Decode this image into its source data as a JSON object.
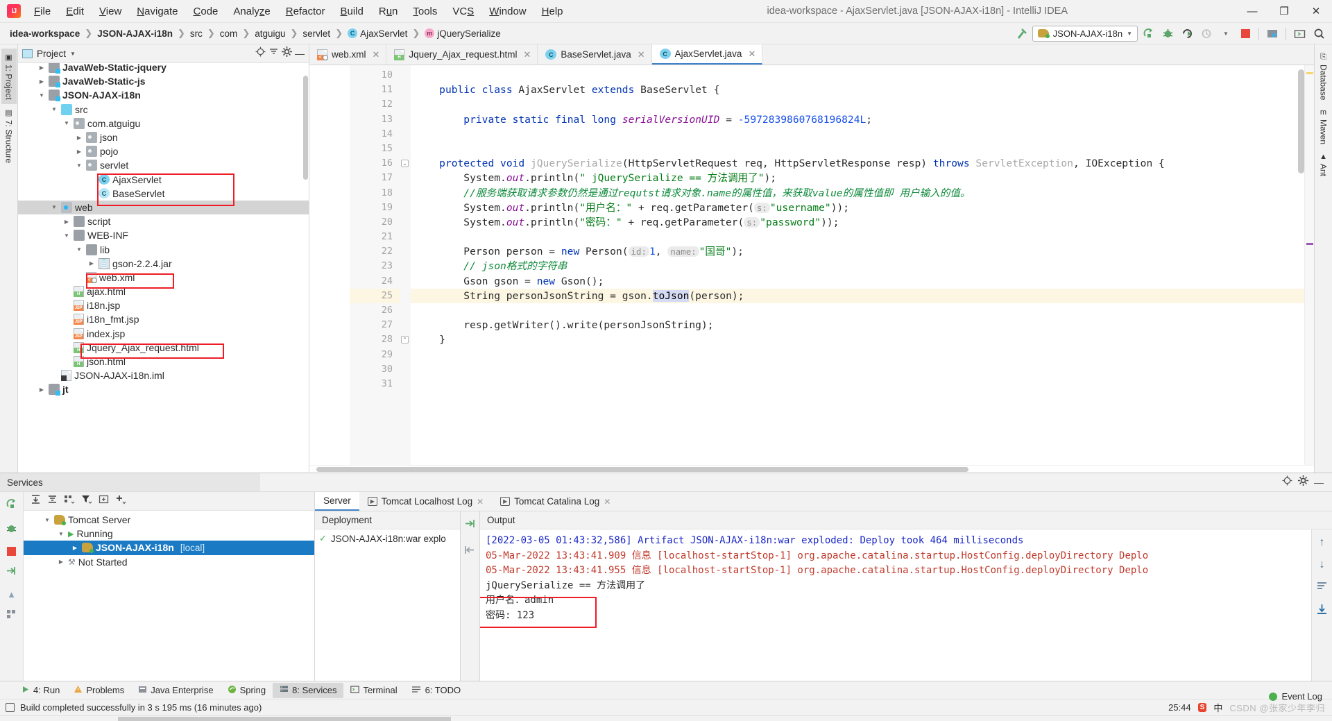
{
  "window": {
    "title": "idea-workspace - AjaxServlet.java [JSON-AJAX-i18n] - IntelliJ IDEA",
    "minimize": "—",
    "maximize": "❐",
    "close": "✕"
  },
  "menu": [
    {
      "label": "File"
    },
    {
      "label": "Edit"
    },
    {
      "label": "View"
    },
    {
      "label": "Navigate"
    },
    {
      "label": "Code"
    },
    {
      "label": "Analyze"
    },
    {
      "label": "Refactor"
    },
    {
      "label": "Build"
    },
    {
      "label": "Run"
    },
    {
      "label": "Tools"
    },
    {
      "label": "VCS"
    },
    {
      "label": "Window"
    },
    {
      "label": "Help"
    }
  ],
  "breadcrumbs": [
    {
      "label": "idea-workspace",
      "bold": true
    },
    {
      "label": "JSON-AJAX-i18n",
      "bold": true
    },
    {
      "label": "src"
    },
    {
      "label": "com"
    },
    {
      "label": "atguigu"
    },
    {
      "label": "servlet"
    },
    {
      "label": "AjaxServlet",
      "icon": "class-icon"
    },
    {
      "label": "jQuerySerialize",
      "icon": "method-icon"
    }
  ],
  "toolbar": {
    "run_config": "JSON-AJAX-i18n",
    "dropdown_caret": "▼",
    "icons": [
      "update-app-icon",
      "debug-icon",
      "run-icon",
      "profile-icon",
      "stop-icon",
      "build-project-icon",
      "terminal-icon",
      "search-everywhere-icon"
    ]
  },
  "left_rail": [
    {
      "label": "1: Project",
      "selected": true
    },
    {
      "label": "7: Structure",
      "selected": false
    }
  ],
  "right_rail": [
    {
      "label": "Database"
    },
    {
      "label": "Maven"
    },
    {
      "label": "Ant"
    }
  ],
  "project_panel": {
    "title": "Project",
    "caret": "▼",
    "tree": [
      {
        "indent": 1,
        "arrow": "▶",
        "icon": "module-folder-icon",
        "label": "JavaWeb-Static-jquery",
        "bold": true,
        "clipped": true
      },
      {
        "indent": 1,
        "arrow": "▶",
        "icon": "module-folder-icon",
        "label": "JavaWeb-Static-js",
        "bold": true
      },
      {
        "indent": 1,
        "arrow": "▼",
        "icon": "module-folder-icon",
        "label": "JSON-AJAX-i18n",
        "bold": true
      },
      {
        "indent": 2,
        "arrow": "▼",
        "icon": "source-folder-icon",
        "label": "src"
      },
      {
        "indent": 3,
        "arrow": "▼",
        "icon": "package-icon",
        "label": "com.atguigu"
      },
      {
        "indent": 4,
        "arrow": "▶",
        "icon": "package-icon",
        "label": "json"
      },
      {
        "indent": 4,
        "arrow": "▶",
        "icon": "package-icon",
        "label": "pojo"
      },
      {
        "indent": 4,
        "arrow": "▼",
        "icon": "package-icon",
        "label": "servlet"
      },
      {
        "indent": 5,
        "arrow": "",
        "icon": "class-icon",
        "label": "AjaxServlet"
      },
      {
        "indent": 5,
        "arrow": "",
        "icon": "abstract-class-icon",
        "label": "BaseServlet"
      },
      {
        "indent": 2,
        "arrow": "▼",
        "icon": "web-folder-icon",
        "label": "web",
        "selected": true
      },
      {
        "indent": 3,
        "arrow": "▶",
        "icon": "plain-folder-icon",
        "label": "script"
      },
      {
        "indent": 3,
        "arrow": "▼",
        "icon": "plain-folder-icon",
        "label": "WEB-INF"
      },
      {
        "indent": 4,
        "arrow": "▼",
        "icon": "plain-folder-icon",
        "label": "lib"
      },
      {
        "indent": 5,
        "arrow": "▶",
        "icon": "jar-icon",
        "label": "gson-2.2.4.jar"
      },
      {
        "indent": 4,
        "arrow": "",
        "icon": "xml-file-icon",
        "label": "web.xml"
      },
      {
        "indent": 3,
        "arrow": "",
        "icon": "html-file-icon",
        "label": "ajax.html"
      },
      {
        "indent": 3,
        "arrow": "",
        "icon": "jsp-file-icon",
        "label": "i18n.jsp"
      },
      {
        "indent": 3,
        "arrow": "",
        "icon": "jsp-file-icon",
        "label": "i18n_fmt.jsp"
      },
      {
        "indent": 3,
        "arrow": "",
        "icon": "jsp-file-icon",
        "label": "index.jsp"
      },
      {
        "indent": 3,
        "arrow": "",
        "icon": "html-file-icon",
        "label": "Jquery_Ajax_request.html"
      },
      {
        "indent": 3,
        "arrow": "",
        "icon": "html-file-icon",
        "label": "json.html"
      },
      {
        "indent": 2,
        "arrow": "",
        "icon": "iml-file-icon",
        "label": "JSON-AJAX-i18n.iml"
      },
      {
        "indent": 1,
        "arrow": "▶",
        "icon": "module-folder-icon",
        "label": "jt",
        "bold": true
      }
    ]
  },
  "editor": {
    "tabs": [
      {
        "label": "web.xml",
        "icon": "xml-file-icon",
        "active": false
      },
      {
        "label": "Jquery_Ajax_request.html",
        "icon": "html-file-icon",
        "active": false
      },
      {
        "label": "BaseServlet.java",
        "icon": "class-icon",
        "active": false
      },
      {
        "label": "AjaxServlet.java",
        "icon": "class-icon",
        "active": true
      }
    ],
    "first_line": 10,
    "highlight_line": 25,
    "lines": [
      {
        "n": 10,
        "segments": []
      },
      {
        "n": 11,
        "segments": [
          {
            "t": "    ",
            "c": "plain"
          },
          {
            "t": "public",
            "c": "kw"
          },
          {
            "t": " ",
            "c": "plain"
          },
          {
            "t": "class",
            "c": "kw"
          },
          {
            "t": " ",
            "c": "plain"
          },
          {
            "t": "AjaxServlet",
            "c": "typ"
          },
          {
            "t": " ",
            "c": "plain"
          },
          {
            "t": "extends",
            "c": "kw"
          },
          {
            "t": " ",
            "c": "plain"
          },
          {
            "t": "BaseServlet {",
            "c": "typ"
          }
        ]
      },
      {
        "n": 12,
        "segments": []
      },
      {
        "n": 13,
        "segments": [
          {
            "t": "        ",
            "c": "plain"
          },
          {
            "t": "private",
            "c": "kw"
          },
          {
            "t": " ",
            "c": "plain"
          },
          {
            "t": "static",
            "c": "kw"
          },
          {
            "t": " ",
            "c": "plain"
          },
          {
            "t": "final",
            "c": "kw"
          },
          {
            "t": " ",
            "c": "plain"
          },
          {
            "t": "long",
            "c": "kw"
          },
          {
            "t": " ",
            "c": "plain"
          },
          {
            "t": "serialVersionUID",
            "c": "fld"
          },
          {
            "t": " = ",
            "c": "plain"
          },
          {
            "t": "-5972839860768196824L",
            "c": "num"
          },
          {
            "t": ";",
            "c": "plain"
          }
        ]
      },
      {
        "n": 14,
        "segments": []
      },
      {
        "n": 15,
        "segments": []
      },
      {
        "n": 16,
        "gutter_mark": "@",
        "fold": true,
        "segments": [
          {
            "t": "    ",
            "c": "plain"
          },
          {
            "t": "protected",
            "c": "kw"
          },
          {
            "t": " ",
            "c": "plain"
          },
          {
            "t": "void",
            "c": "kw"
          },
          {
            "t": " ",
            "c": "plain"
          },
          {
            "t": "jQuerySerialize",
            "c": "dim"
          },
          {
            "t": "(HttpServletRequest req, HttpServletResponse resp) ",
            "c": "typ"
          },
          {
            "t": "throws",
            "c": "kw"
          },
          {
            "t": " ",
            "c": "plain"
          },
          {
            "t": "ServletException",
            "c": "dim"
          },
          {
            "t": ", ",
            "c": "typ"
          },
          {
            "t": "IOException {",
            "c": "typ"
          }
        ]
      },
      {
        "n": 17,
        "segments": [
          {
            "t": "        ",
            "c": "plain"
          },
          {
            "t": "System.",
            "c": "typ"
          },
          {
            "t": "out",
            "c": "stat"
          },
          {
            "t": ".println(",
            "c": "typ"
          },
          {
            "t": "\"  jQuerySerialize   == 方法调用了\"",
            "c": "str"
          },
          {
            "t": ");",
            "c": "typ"
          }
        ]
      },
      {
        "n": 18,
        "segments": [
          {
            "t": "        ",
            "c": "plain"
          },
          {
            "t": "//服务端获取请求参数仍然是通过requtst请求对象.name的属性值，来获取value的属性值即 用户输入的值。",
            "c": "cmt"
          }
        ]
      },
      {
        "n": 19,
        "segments": [
          {
            "t": "        ",
            "c": "plain"
          },
          {
            "t": "System.",
            "c": "typ"
          },
          {
            "t": "out",
            "c": "stat"
          },
          {
            "t": ".println(",
            "c": "typ"
          },
          {
            "t": "\"用户名：\"",
            "c": "str"
          },
          {
            "t": " + req.getParameter(",
            "c": "typ"
          },
          {
            "t": "s:",
            "c": "hint"
          },
          {
            "t": "\"username\"",
            "c": "str"
          },
          {
            "t": "));",
            "c": "typ"
          }
        ]
      },
      {
        "n": 20,
        "segments": [
          {
            "t": "        ",
            "c": "plain"
          },
          {
            "t": "System.",
            "c": "typ"
          },
          {
            "t": "out",
            "c": "stat"
          },
          {
            "t": ".println(",
            "c": "typ"
          },
          {
            "t": "\"密码：\"",
            "c": "str"
          },
          {
            "t": " + req.getParameter(",
            "c": "typ"
          },
          {
            "t": "s:",
            "c": "hint"
          },
          {
            "t": "\"password\"",
            "c": "str"
          },
          {
            "t": "));",
            "c": "typ"
          }
        ]
      },
      {
        "n": 21,
        "segments": []
      },
      {
        "n": 22,
        "segments": [
          {
            "t": "        ",
            "c": "plain"
          },
          {
            "t": "Person person = ",
            "c": "typ"
          },
          {
            "t": "new",
            "c": "kw"
          },
          {
            "t": " Person(",
            "c": "typ"
          },
          {
            "t": "id:",
            "c": "hint"
          },
          {
            "t": "1",
            "c": "num"
          },
          {
            "t": ", ",
            "c": "typ"
          },
          {
            "t": "name:",
            "c": "hint"
          },
          {
            "t": "\"国哥\"",
            "c": "str"
          },
          {
            "t": ");",
            "c": "typ"
          }
        ]
      },
      {
        "n": 23,
        "segments": [
          {
            "t": "        ",
            "c": "plain"
          },
          {
            "t": "// json格式的字符串",
            "c": "cmt"
          }
        ]
      },
      {
        "n": 24,
        "segments": [
          {
            "t": "        ",
            "c": "plain"
          },
          {
            "t": "Gson gson = ",
            "c": "typ"
          },
          {
            "t": "new",
            "c": "kw"
          },
          {
            "t": " Gson();",
            "c": "typ"
          }
        ]
      },
      {
        "n": 25,
        "gutter_mark": "bulb",
        "segments": [
          {
            "t": "        ",
            "c": "plain"
          },
          {
            "t": "String personJsonString = gson.",
            "c": "typ"
          },
          {
            "t": "toJson",
            "c": "seltok"
          },
          {
            "t": "(person);",
            "c": "typ"
          }
        ]
      },
      {
        "n": 26,
        "segments": []
      },
      {
        "n": 27,
        "segments": [
          {
            "t": "        ",
            "c": "plain"
          },
          {
            "t": "resp.getWriter().write(personJsonString);",
            "c": "typ"
          }
        ]
      },
      {
        "n": 28,
        "fold": true,
        "segments": [
          {
            "t": "    ",
            "c": "plain"
          },
          {
            "t": "}",
            "c": "typ"
          }
        ]
      },
      {
        "n": 29,
        "segments": []
      },
      {
        "n": 30,
        "segments": []
      },
      {
        "n": 31,
        "segments": []
      }
    ]
  },
  "services": {
    "panel_title": "Services",
    "toolbar_icons": [
      "rerun-icon",
      "expand-all-icon",
      "collapse-all-icon",
      "group-icon",
      "filter-icon",
      "add-frame-icon",
      "add-icon"
    ],
    "rail_icons": [
      "rerun-icon",
      "debug-icon",
      "stop-icon",
      "deploy-icon",
      "up-icon",
      "settings-icon"
    ],
    "tree": [
      {
        "indent": 1,
        "arrow": "▼",
        "icon": "tomcat-icon",
        "label": "Tomcat Server"
      },
      {
        "indent": 2,
        "arrow": "▼",
        "icon": "run-icon",
        "label": "Running"
      },
      {
        "indent": 3,
        "arrow": "▶",
        "icon": "tomcat-icon",
        "label": "JSON-AJAX-i18n",
        "suffix": "[local]",
        "selected": true
      },
      {
        "indent": 2,
        "arrow": "▶",
        "icon": "wrench-icon",
        "label": "Not Started"
      }
    ],
    "tabs": [
      {
        "label": "Server",
        "active": true
      },
      {
        "label": "Tomcat Localhost Log",
        "icon": "log-icon",
        "active": false,
        "closable": true
      },
      {
        "label": "Tomcat Catalina Log",
        "icon": "log-icon",
        "active": false,
        "closable": true
      }
    ],
    "deployment": {
      "header": "Deployment",
      "item": "JSON-AJAX-i18n:war explo"
    },
    "output": {
      "header": "Output",
      "lines": [
        {
          "text": "[2022-03-05 01:43:32,586] Artifact JSON-AJAX-i18n:war exploded: Deploy took 464 milliseconds",
          "color": "blue"
        },
        {
          "text": "05-Mar-2022 13:43:41.909 信息 [localhost-startStop-1] org.apache.catalina.startup.HostConfig.deployDirectory Deplo",
          "color": "red"
        },
        {
          "text": "05-Mar-2022 13:43:41.955 信息 [localhost-startStop-1] org.apache.catalina.startup.HostConfig.deployDirectory Deplo",
          "color": "red"
        },
        {
          "text": "  jQuerySerialize   == 方法调用了",
          "color": "blk"
        },
        {
          "text": "用户名：admin",
          "color": "blk",
          "boxed": true
        },
        {
          "text": "密码: 123",
          "color": "blk",
          "boxed": true
        }
      ]
    }
  },
  "tool_window_bar": [
    {
      "label": "4: Run",
      "icon": "run-icon",
      "active": false
    },
    {
      "label": "Problems",
      "icon": "warning-icon",
      "active": false
    },
    {
      "label": "Java Enterprise",
      "icon": "java-icon",
      "active": false
    },
    {
      "label": "Spring",
      "icon": "spring-icon",
      "active": false
    },
    {
      "label": "8: Services",
      "icon": "services-icon",
      "active": true
    },
    {
      "label": "Terminal",
      "icon": "terminal-icon",
      "active": false
    },
    {
      "label": "6: TODO",
      "icon": "todo-icon",
      "active": false
    }
  ],
  "status": {
    "message": "Build completed successfully in 3 s 195 ms (16 minutes ago)",
    "caret_position": "25:44",
    "event_log": "Event Log",
    "ime": "中",
    "watermark": "CSDN @张家少年李归"
  }
}
